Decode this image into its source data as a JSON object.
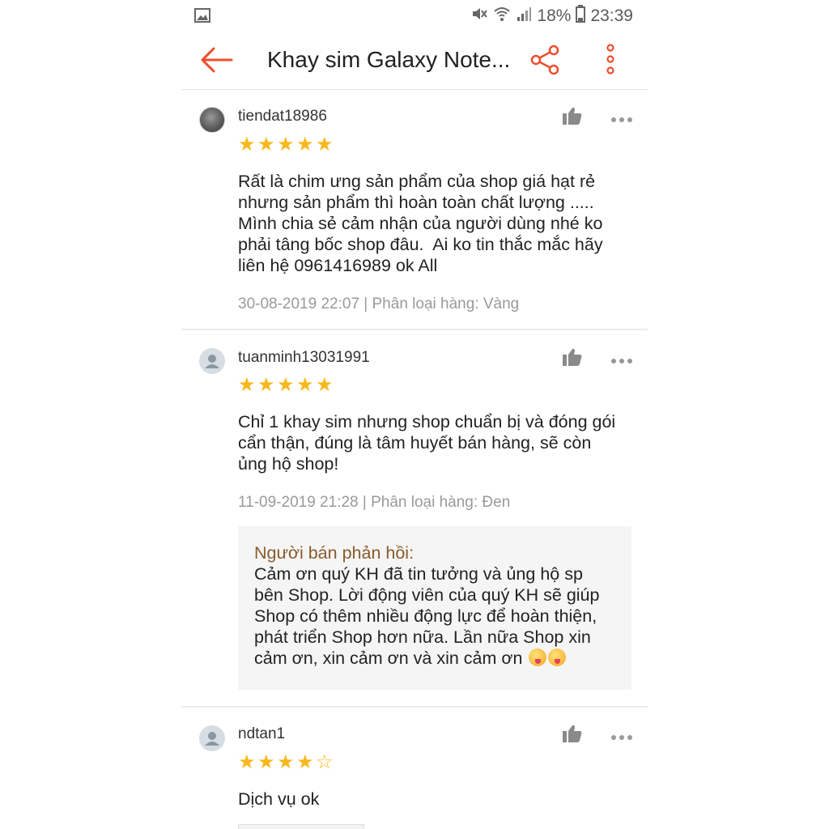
{
  "status_bar": {
    "battery": "18%",
    "time": "23:39"
  },
  "app_bar": {
    "title": "Khay sim Galaxy Note...",
    "accent": "#ee4d2d"
  },
  "reviews": [
    {
      "username": "tiendat18986",
      "rating": 5,
      "text": "Rất là chim ưng sản phẩm của shop giá hạt rẻ\nnhưng sản phẩm thì hoàn toàn chất lượng .....\nMình chia sẻ cảm nhận của người dùng nhé ko\nphải tâng bốc shop đâu.  Ai ko tin thắc mắc hãy\nliên hệ 0961416989 ok All",
      "meta": "30-08-2019 22:07 | Phân loại hàng: Vàng"
    },
    {
      "username": "tuanminh13031991",
      "rating": 5,
      "text": "Chỉ 1 khay sim nhưng shop chuẩn bị và đóng gói\ncẩn thận, đúng là tâm huyết bán hàng, sẽ còn\nủng hộ shop!",
      "meta": "11-09-2019 21:28 | Phân loại hàng: Đen",
      "seller_reply": {
        "label": "Người bán phản hồi:",
        "text": "Cảm ơn quý KH đã tin tưởng và ủng hộ sp\nbên Shop. Lời động viên của quý KH sẽ giúp\nShop có thêm nhiều động lực để hoàn thiện,\nphát triển Shop hơn nữa. Lần nữa Shop xin\ncảm ơn, xin cảm ơn và xin cảm ơn"
      }
    },
    {
      "username": "ndtan1",
      "rating": 4,
      "text": "Dịch vụ ok"
    }
  ],
  "colors": {
    "star": "#f8b81b",
    "reply_label": "#8a5a2b",
    "meta": "#9a9a9a"
  }
}
